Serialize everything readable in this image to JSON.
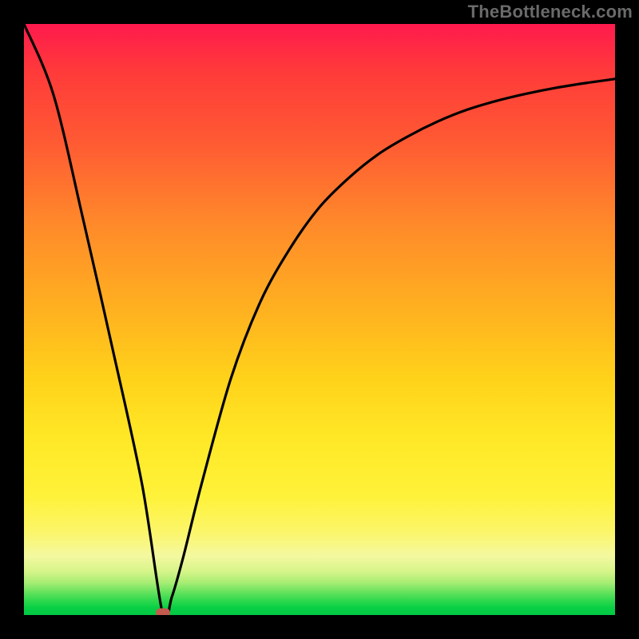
{
  "watermark": "TheBottleneck.com",
  "colors": {
    "frame": "#000000",
    "curve": "#000000",
    "marker": "#c25a4e",
    "gradient_top": "#ff1a4d",
    "gradient_bottom": "#02c844"
  },
  "chart_data": {
    "type": "line",
    "title": "",
    "xlabel": "",
    "ylabel": "",
    "xlim": [
      0,
      100
    ],
    "ylim": [
      0,
      100
    ],
    "grid": false,
    "series": [
      {
        "name": "bottleneck-curve",
        "x": [
          0,
          5,
          10,
          15,
          20,
          23.5,
          25,
          27,
          30,
          35,
          40,
          45,
          50,
          55,
          60,
          65,
          70,
          75,
          80,
          85,
          90,
          95,
          100
        ],
        "y": [
          100,
          88,
          67,
          45,
          22,
          0,
          3,
          10,
          22,
          40,
          53,
          62,
          69,
          74,
          78,
          81,
          83.5,
          85.5,
          87,
          88.2,
          89.2,
          90,
          90.7
        ]
      }
    ],
    "marker": {
      "x": 23.5,
      "y": 0,
      "shape": "pill"
    },
    "background": "vertical-gradient red→yellow→green"
  }
}
